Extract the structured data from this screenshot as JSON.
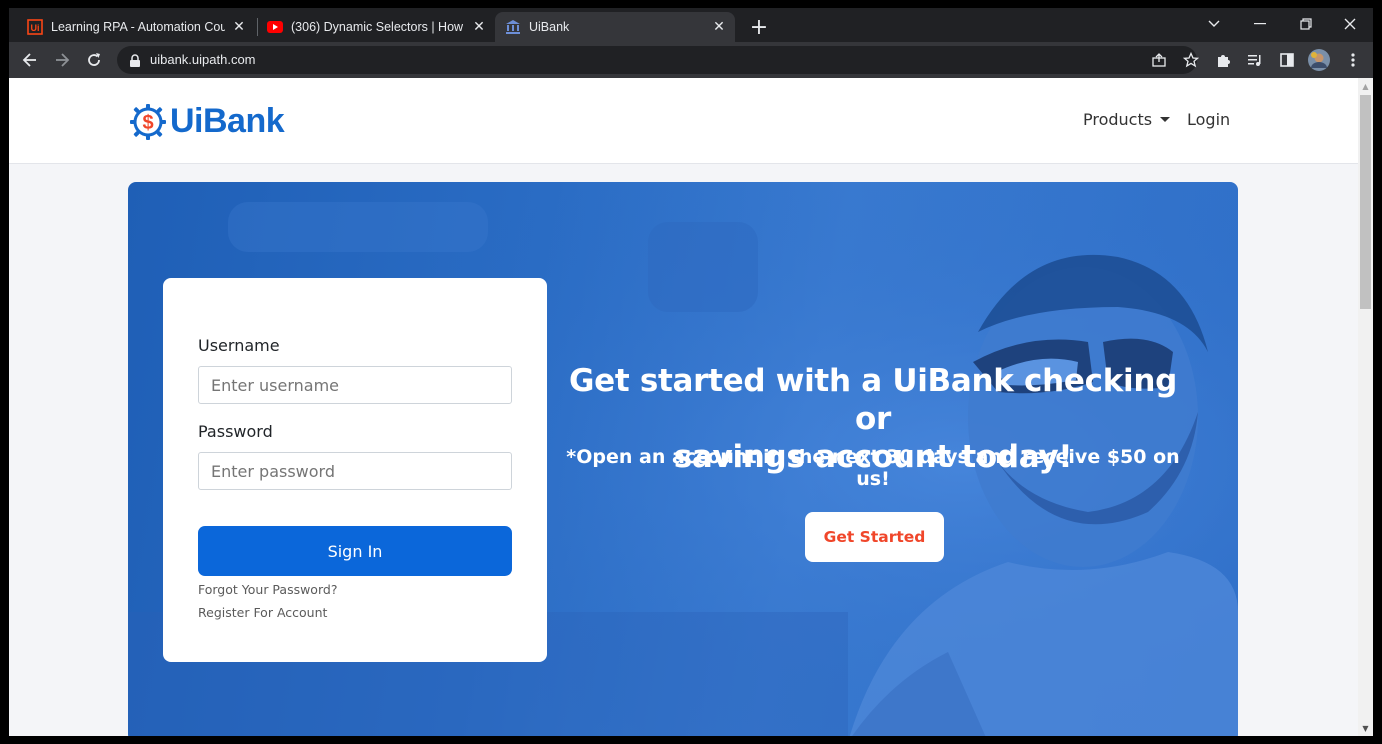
{
  "browser": {
    "tabs": [
      {
        "title": "Learning RPA - Automation Cour",
        "active": false
      },
      {
        "title": "(306) Dynamic Selectors | How to",
        "active": false
      },
      {
        "title": "UiBank",
        "active": true
      }
    ],
    "new_tab_label": "+",
    "address": "uibank.uipath.com"
  },
  "site": {
    "brand": "UiBank",
    "nav": {
      "products_label": "Products",
      "login_label": "Login"
    }
  },
  "login": {
    "username_label": "Username",
    "username_placeholder": "Enter username",
    "password_label": "Password",
    "password_placeholder": "Enter password",
    "signin_label": "Sign In",
    "forgot_label": "Forgot Your Password?",
    "register_label": "Register For Account"
  },
  "hero": {
    "headline_line1": "Get started with a UiBank checking or",
    "headline_line2": "savings account today!",
    "subline": "*Open an account in the next 30 days and receive $50 on us!",
    "cta_label": "Get Started"
  },
  "colors": {
    "brand_blue": "#1469cc",
    "accent_orange": "#f0462a",
    "button_blue": "#0b67da"
  },
  "icons": [
    "uipath-favicon",
    "youtube-favicon",
    "bank-favicon",
    "back-icon",
    "forward-icon",
    "reload-icon",
    "lock-icon",
    "share-icon",
    "star-icon",
    "extensions-icon",
    "media-icon",
    "sidepanel-icon",
    "profile-avatar",
    "menu-icon",
    "dollar-gear-logo"
  ]
}
